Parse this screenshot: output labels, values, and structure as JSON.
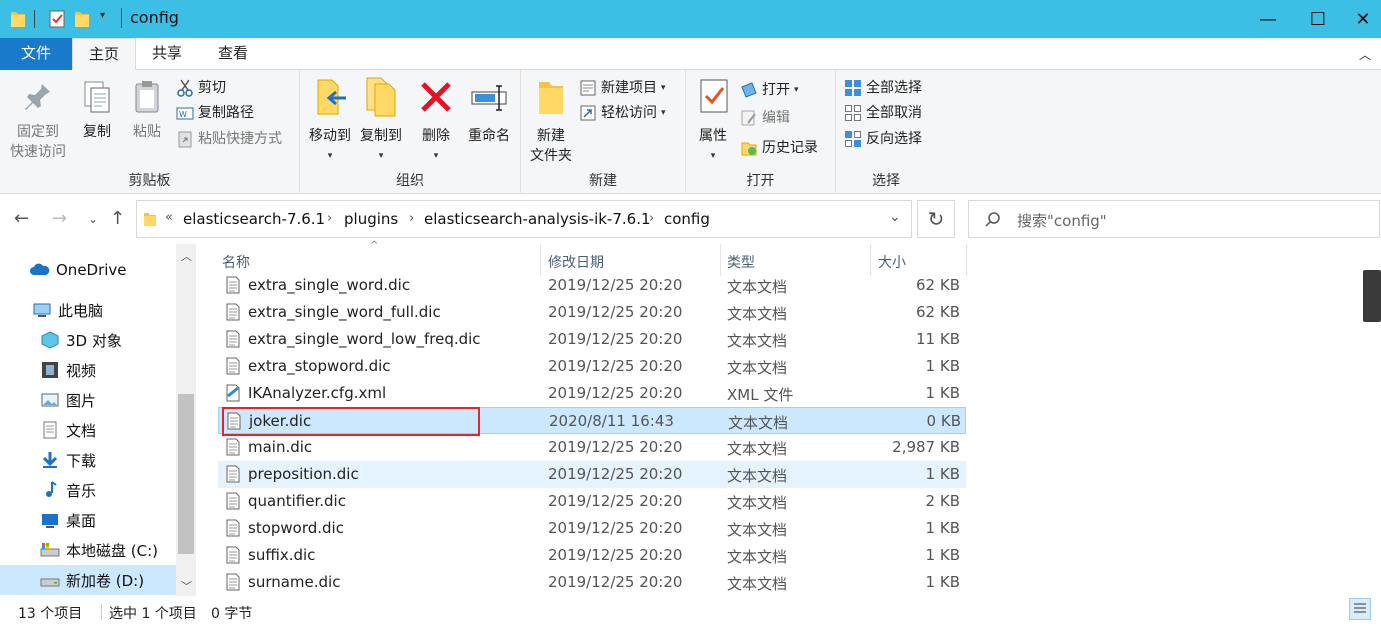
{
  "window": {
    "title": "config",
    "minimize_glyph": "—",
    "maximize_glyph": "☐",
    "close_glyph": "✕"
  },
  "ribbon_tabs": [
    {
      "label": "文件"
    },
    {
      "label": "主页"
    },
    {
      "label": "共享"
    },
    {
      "label": "查看"
    }
  ],
  "ribbon": {
    "clipboard": {
      "label": "剪贴板",
      "pin": "固定到\n快速访问",
      "pin_line1": "固定到",
      "pin_line2": "快速访问",
      "copy": "复制",
      "paste": "粘贴",
      "cut": "剪切",
      "copy_path": "复制路径",
      "paste_shortcut": "粘贴快捷方式"
    },
    "organize": {
      "label": "组织",
      "move_to": "移动到",
      "copy_to": "复制到",
      "delete": "删除",
      "rename": "重命名"
    },
    "new": {
      "label": "新建",
      "new_folder_line1": "新建",
      "new_folder_line2": "文件夹",
      "new_item": "新建项目",
      "easy_access": "轻松访问"
    },
    "open": {
      "label": "打开",
      "properties": "属性",
      "open": "打开",
      "edit": "编辑",
      "history": "历史记录"
    },
    "select": {
      "label": "选择",
      "select_all": "全部选择",
      "select_none": "全部取消",
      "invert": "反向选择"
    }
  },
  "address": {
    "overflow": "«",
    "crumbs": [
      "elasticsearch-7.6.1",
      "plugins",
      "elasticsearch-analysis-ik-7.6.1",
      "config"
    ],
    "search_placeholder": "搜索\"config\""
  },
  "sidebar": {
    "items": [
      {
        "label": "OneDrive",
        "icon": "cloud-icon"
      },
      {
        "label": "此电脑",
        "icon": "computer-icon"
      },
      {
        "label": "3D 对象",
        "icon": "cube-icon"
      },
      {
        "label": "视频",
        "icon": "film-icon"
      },
      {
        "label": "图片",
        "icon": "picture-icon"
      },
      {
        "label": "文档",
        "icon": "document-icon"
      },
      {
        "label": "下载",
        "icon": "download-icon"
      },
      {
        "label": "音乐",
        "icon": "music-icon"
      },
      {
        "label": "桌面",
        "icon": "desktop-icon"
      },
      {
        "label": "本地磁盘 (C:)",
        "icon": "drive-c-icon"
      },
      {
        "label": "新加卷 (D:)",
        "icon": "drive-icon"
      }
    ]
  },
  "columns": {
    "name": "名称",
    "date": "修改日期",
    "type": "类型",
    "size": "大小"
  },
  "files": [
    {
      "name": "extra_single_word.dic",
      "date": "2019/12/25 20:20",
      "type": "文本文档",
      "size": "62 KB"
    },
    {
      "name": "extra_single_word_full.dic",
      "date": "2019/12/25 20:20",
      "type": "文本文档",
      "size": "62 KB"
    },
    {
      "name": "extra_single_word_low_freq.dic",
      "date": "2019/12/25 20:20",
      "type": "文本文档",
      "size": "11 KB"
    },
    {
      "name": "extra_stopword.dic",
      "date": "2019/12/25 20:20",
      "type": "文本文档",
      "size": "1 KB"
    },
    {
      "name": "IKAnalyzer.cfg.xml",
      "date": "2019/12/25 20:20",
      "type": "XML 文件",
      "size": "1 KB"
    },
    {
      "name": "joker.dic",
      "date": "2020/8/11 16:43",
      "type": "文本文档",
      "size": "0 KB"
    },
    {
      "name": "main.dic",
      "date": "2019/12/25 20:20",
      "type": "文本文档",
      "size": "2,987 KB"
    },
    {
      "name": "preposition.dic",
      "date": "2019/12/25 20:20",
      "type": "文本文档",
      "size": "1 KB"
    },
    {
      "name": "quantifier.dic",
      "date": "2019/12/25 20:20",
      "type": "文本文档",
      "size": "2 KB"
    },
    {
      "name": "stopword.dic",
      "date": "2019/12/25 20:20",
      "type": "文本文档",
      "size": "1 KB"
    },
    {
      "name": "suffix.dic",
      "date": "2019/12/25 20:20",
      "type": "文本文档",
      "size": "1 KB"
    },
    {
      "name": "surname.dic",
      "date": "2019/12/25 20:20",
      "type": "文本文档",
      "size": "1 KB"
    }
  ],
  "status": {
    "count": "13 个项目",
    "selection": "选中 1 个项目",
    "size": "0 字节"
  },
  "colors": {
    "titlebar": "#3bbfe4",
    "file_tab": "#1979ca",
    "selection": "#cce8ff",
    "highlight_box": "#e8242a"
  }
}
